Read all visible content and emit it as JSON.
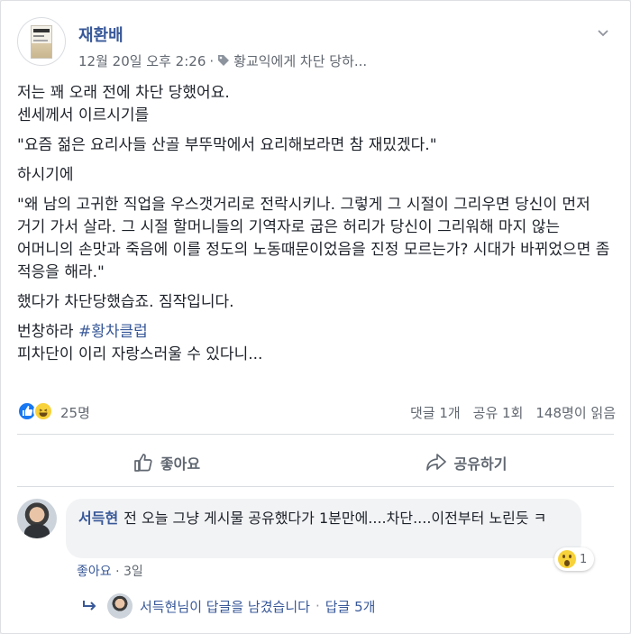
{
  "post": {
    "author": "재환배",
    "timestamp": "12월 20일 오후 2:26",
    "separator": "·",
    "feeling": "황교익에게 차단 당하...",
    "paragraphs": [
      "저는 꽤 오래 전에 차단 당했어요.\n센세께서 이르시기를",
      "\"요즘 젊은 요리사들 산골 부뚜막에서 요리해보라면 참 재밌겠다.\"",
      "하시기에",
      "\"왜 남의 고귀한 직업을 우스갯거리로 전락시키나. 그렇게 그 시절이 그리우면 당신이 먼저 거기 가서 살라. 그 시절 할머니들의 기역자로 굽은 허리가 당신이 그리워해 마지 않는 어머니의 손맛과 죽음에 이를 정도의 노동때문이었음을 진정 모르는가? 시대가 바뀌었으면 좀 적응을 해라.\"",
      "했다가 차단당했습죠. 짐작입니다."
    ],
    "last_para_prefix": "번창하라 ",
    "hashtag": "#황차클럽",
    "last_line": "피차단이 이리 자랑스러울 수 있다니..."
  },
  "stats": {
    "reactions_count": "25명",
    "comments": "댓글 1개",
    "shares": "공유 1회",
    "views": "148명이 읽음"
  },
  "actions": {
    "like_label": "좋아요",
    "share_label": "공유하기"
  },
  "comment": {
    "author": "서득현",
    "text": "전 오늘 그냥 게시물 공유했다가 1분만에....차단....이전부터 노린듯 ㅋ",
    "reaction_count": "1",
    "like_label": "좋아요",
    "separator": "·",
    "age": "3일"
  },
  "replies": {
    "text": "서득현님이 답글을 남겼습니다",
    "separator": "·",
    "count": "답글 5개"
  },
  "colors": {
    "link": "#385898",
    "meta": "#616770",
    "like_blue": "#1877f2"
  }
}
